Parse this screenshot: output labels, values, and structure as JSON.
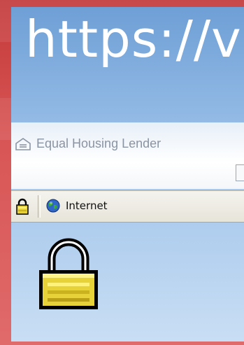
{
  "address_bar": {
    "url_fragment": "https://v"
  },
  "page": {
    "equal_housing_label": "Equal Housing Lender"
  },
  "status_bar": {
    "zone_label": "Internet"
  },
  "icons": {
    "status_lock": "padlock-icon",
    "zone_globe": "globe-icon",
    "equal_housing": "house-icon",
    "large_lock": "padlock-icon"
  },
  "colors": {
    "lock_gold": "#e8d23a",
    "lock_outline": "#000000",
    "titlebar_blue": "#6e9fd6"
  }
}
